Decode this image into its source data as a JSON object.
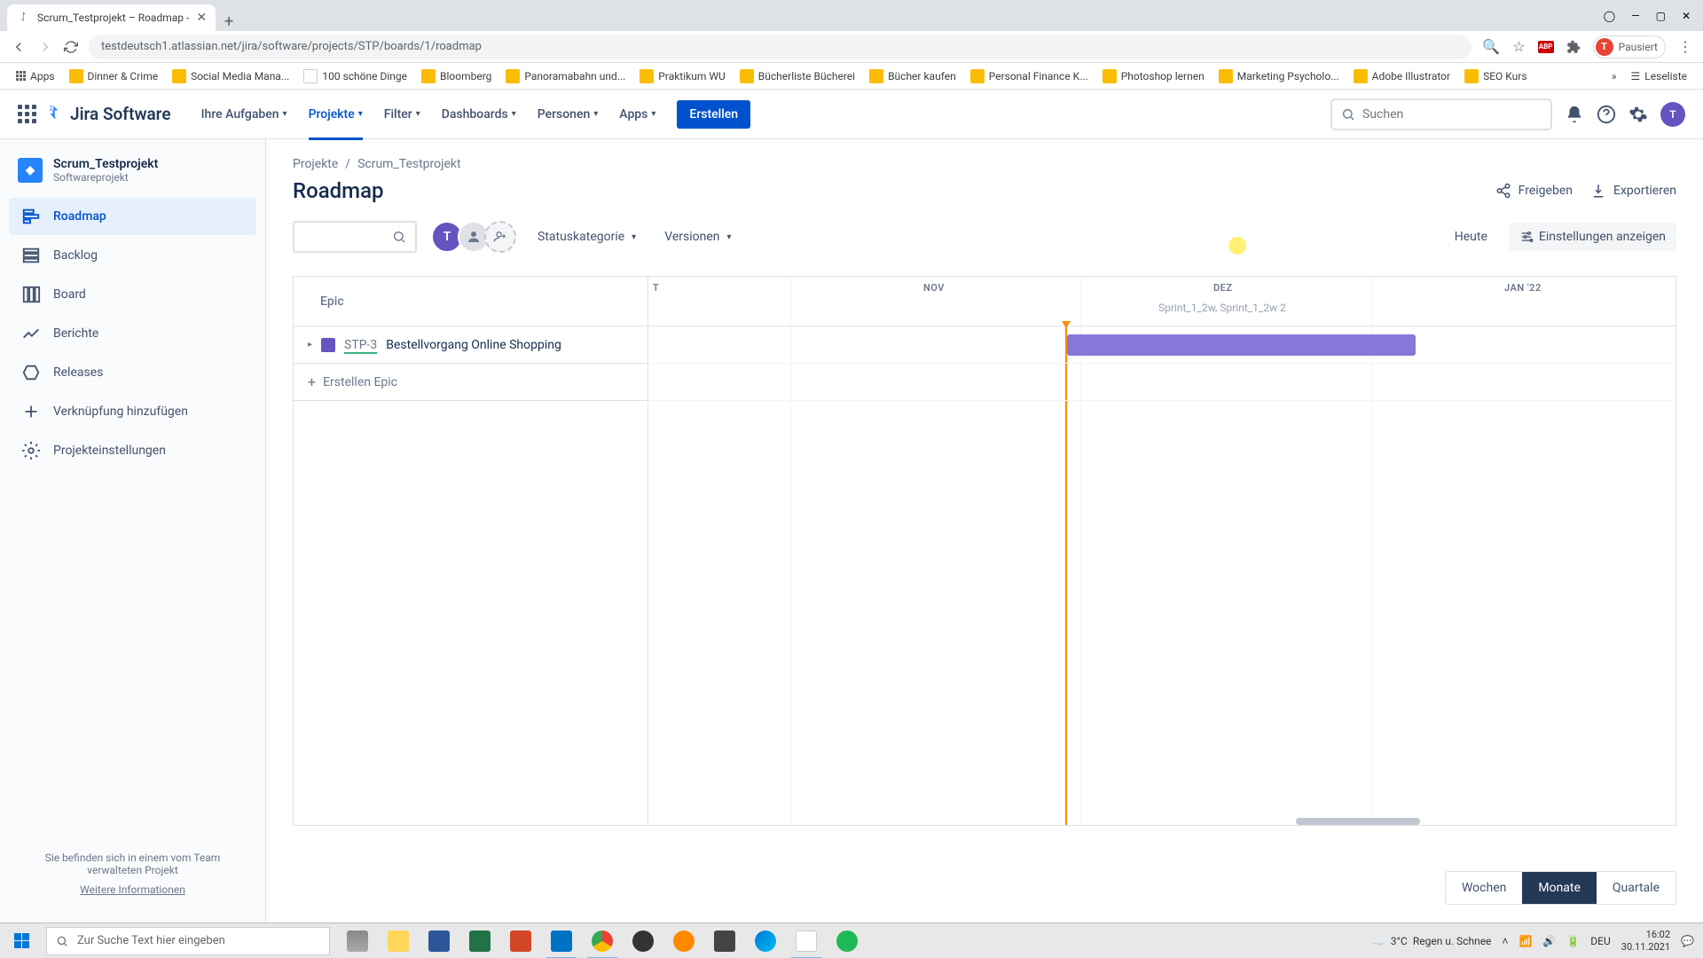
{
  "browser": {
    "tab_title": "Scrum_Testprojekt – Roadmap - ",
    "url_display": "testdeutsch1.atlassian.net/jira/software/projects/STP/boards/1/roadmap",
    "profile_status": "Pausiert",
    "bookmarks": [
      "Apps",
      "Dinner & Crime",
      "Social Media Mana...",
      "100 schöne Dinge",
      "Bloomberg",
      "Panoramabahn und...",
      "Praktikum WU",
      "Bücherliste Bücherei",
      "Bücher kaufen",
      "Personal Finance K...",
      "Photoshop lernen",
      "Marketing Psycholo...",
      "Adobe Illustrator",
      "SEO Kurs"
    ],
    "reading_list": "Leseliste"
  },
  "jira": {
    "product": "Jira Software",
    "nav": {
      "your_work": "Ihre Aufgaben",
      "projects": "Projekte",
      "filters": "Filter",
      "dashboards": "Dashboards",
      "people": "Personen",
      "apps": "Apps",
      "create": "Erstellen"
    },
    "search_placeholder": "Suchen",
    "avatar_letter": "T"
  },
  "sidebar": {
    "project_name": "Scrum_Testprojekt",
    "project_type": "Softwareprojekt",
    "items": {
      "roadmap": "Roadmap",
      "backlog": "Backlog",
      "board": "Board",
      "reports": "Berichte",
      "releases": "Releases",
      "add_link": "Verknüpfung hinzufügen",
      "settings": "Projekteinstellungen"
    },
    "footer1": "Sie befinden sich in einem vom Team verwalteten Projekt",
    "footer2": "Weitere Informationen"
  },
  "breadcrumb": {
    "projects": "Projekte",
    "current": "Scrum_Testprojekt"
  },
  "page": {
    "title": "Roadmap",
    "share": "Freigeben",
    "export": "Exportieren"
  },
  "toolbar": {
    "status": "Statuskategorie",
    "versions": "Versionen",
    "today": "Heute",
    "show_settings": "Einstellungen anzeigen",
    "avatar1": "T"
  },
  "roadmap": {
    "epic_header": "Epic",
    "months": {
      "okt": "T",
      "nov": "NOV",
      "dez": "DEZ",
      "jan": "JAN '22"
    },
    "sprint_label": "Sprint_1_2w, Sprint_1_2w 2",
    "epic": {
      "key": "STP-3",
      "summary": "Bestellvorgang Online Shopping"
    },
    "create_epic": "Erstellen Epic",
    "view": {
      "weeks": "Wochen",
      "months": "Monate",
      "quarters": "Quartale"
    }
  },
  "taskbar": {
    "search_placeholder": "Zur Suche Text hier eingeben",
    "weather_temp": "3°C",
    "weather_text": "Regen u. Schnee",
    "lang": "DEU",
    "time": "16:02",
    "date": "30.11.2021"
  }
}
